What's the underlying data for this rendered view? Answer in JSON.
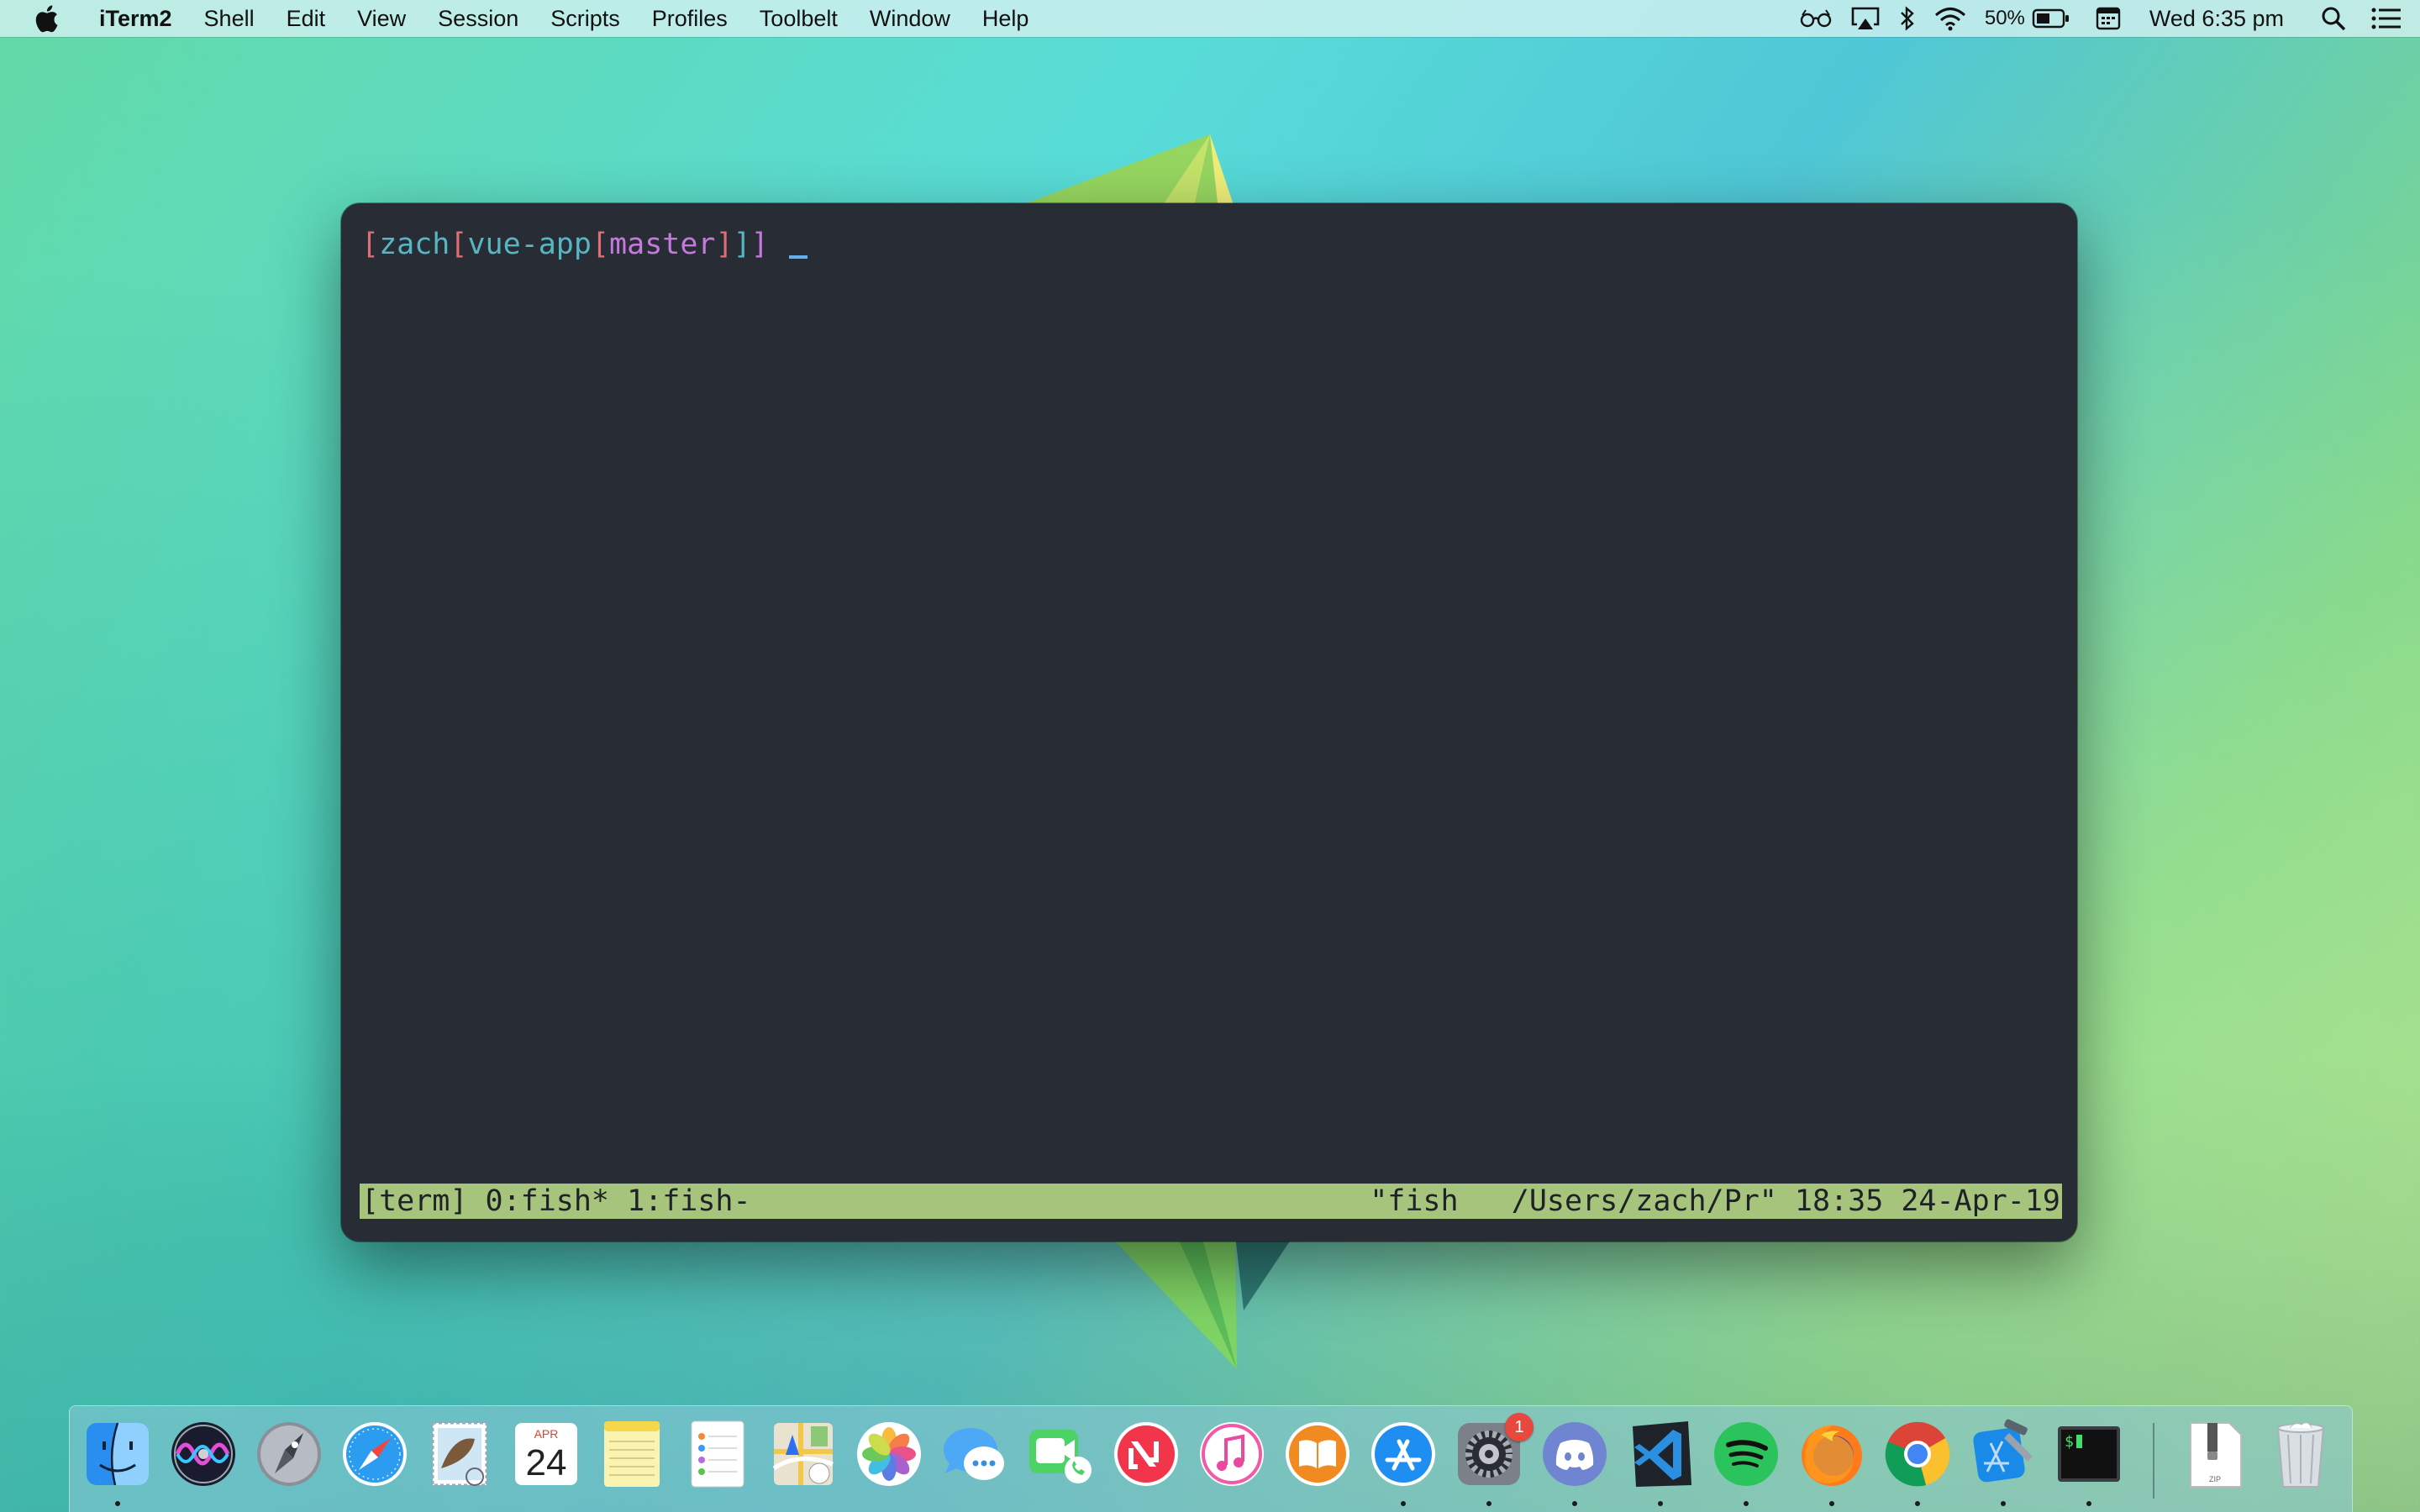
{
  "menubar": {
    "app_name": "iTerm2",
    "menus": [
      "Shell",
      "Edit",
      "View",
      "Session",
      "Scripts",
      "Profiles",
      "Toolbelt",
      "Window",
      "Help"
    ],
    "battery_percent": "50%",
    "clock": "Wed 6:35 pm",
    "status_icons": [
      "glasses-icon",
      "airplay-icon",
      "bluetooth-icon",
      "wifi-icon",
      "battery-icon",
      "calendar-icon",
      "search-icon",
      "notification-center-icon"
    ]
  },
  "terminal": {
    "prompt": {
      "open1": "[",
      "user": "zach",
      "open2": "[",
      "dir": "vue-app",
      "open3": "[",
      "branch": "master",
      "close3": "]",
      "close2": "]",
      "close1": "]"
    },
    "status_left": "[term] 0:fish* 1:fish-",
    "status_right": "\"fish   /Users/zach/Pr\" 18:35 24-Apr-19",
    "colors": {
      "background": "#282c35",
      "status_bar": "#a6c47b",
      "red": "#e06c75",
      "cyan": "#56b6c2",
      "purple": "#c678dd",
      "cursor": "#61afef"
    }
  },
  "calendar_icon": {
    "month": "APR",
    "day": "24"
  },
  "dock": {
    "items": [
      {
        "name": "finder",
        "running": true
      },
      {
        "name": "siri",
        "running": false
      },
      {
        "name": "launchpad",
        "running": false
      },
      {
        "name": "safari",
        "running": false
      },
      {
        "name": "mail",
        "running": false
      },
      {
        "name": "calendar",
        "running": false
      },
      {
        "name": "notes",
        "running": false
      },
      {
        "name": "reminders",
        "running": false
      },
      {
        "name": "maps",
        "running": false
      },
      {
        "name": "photos",
        "running": false
      },
      {
        "name": "messages",
        "running": false
      },
      {
        "name": "facetime",
        "running": false
      },
      {
        "name": "news",
        "running": false
      },
      {
        "name": "itunes",
        "running": false
      },
      {
        "name": "books",
        "running": false
      },
      {
        "name": "app-store",
        "running": true
      },
      {
        "name": "system-preferences",
        "running": true,
        "badge": "1"
      },
      {
        "name": "discord",
        "running": true
      },
      {
        "name": "vscode",
        "running": true
      },
      {
        "name": "spotify",
        "running": true
      },
      {
        "name": "firefox",
        "running": true
      },
      {
        "name": "chrome",
        "running": true
      },
      {
        "name": "xcode",
        "running": true
      },
      {
        "name": "iterm2",
        "running": true
      },
      {
        "name": "archive-zip",
        "running": false
      },
      {
        "name": "trash",
        "running": false
      }
    ],
    "archive_label": "ZIP"
  }
}
